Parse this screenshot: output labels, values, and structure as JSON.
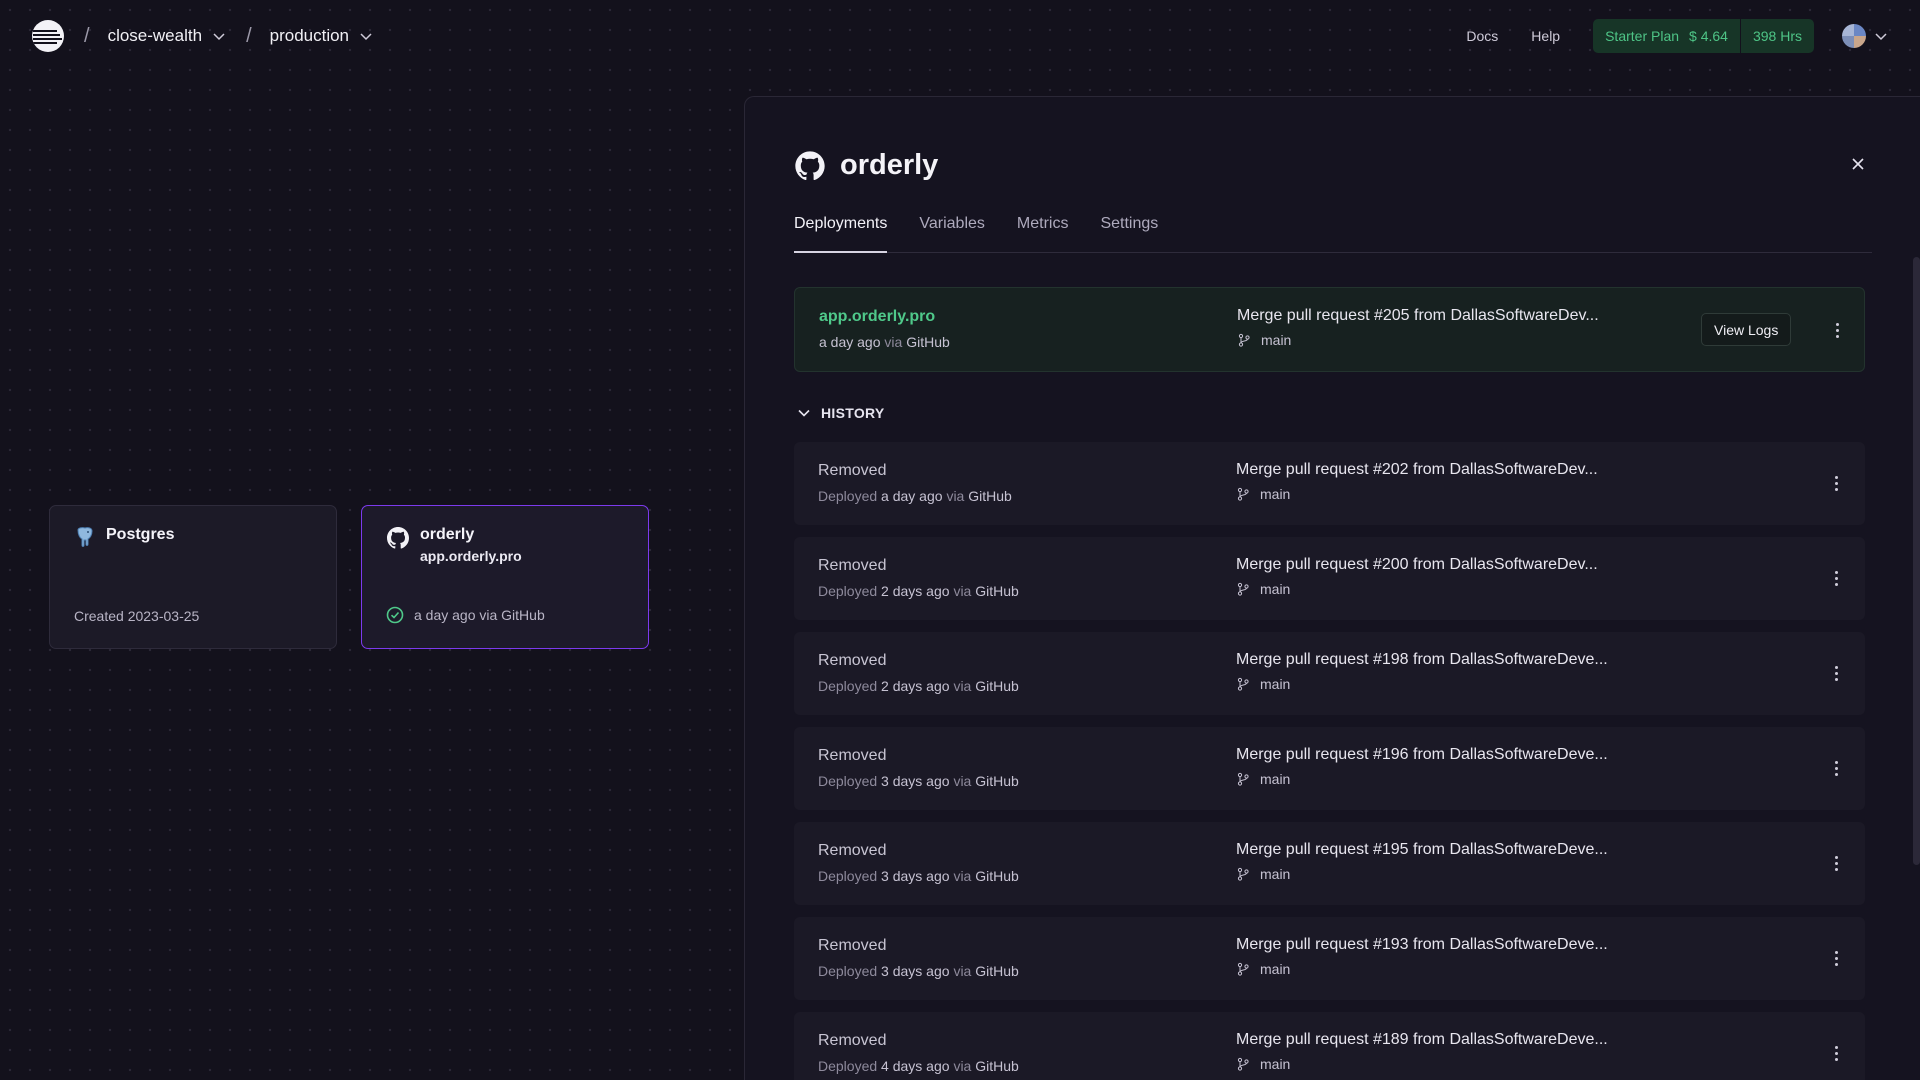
{
  "topbar": {
    "project": "close-wealth",
    "environment": "production",
    "links": [
      "Docs",
      "Help"
    ],
    "plan": {
      "name": "Starter Plan",
      "cost": "$ 4.64",
      "hours": "398 Hrs"
    }
  },
  "canvas": {
    "postgres": {
      "title": "Postgres",
      "footer": "Created 2023-03-25",
      "icon": "postgres-elephant-icon"
    },
    "orderly": {
      "title": "orderly",
      "subtitle": "app.orderly.pro",
      "footer": "a day ago via GitHub",
      "icon": "github-icon",
      "status_icon": "check-circle-icon"
    }
  },
  "panel": {
    "title": "orderly",
    "tabs": [
      "Deployments",
      "Variables",
      "Metrics",
      "Settings"
    ],
    "active_tab": "Deployments",
    "active_deployment": {
      "domain": "app.orderly.pro",
      "time": "a day ago",
      "via_word": "via",
      "source": "GitHub",
      "commit": "Merge pull request #205 from DallasSoftwareDev...",
      "branch": "main",
      "view_logs": "View Logs"
    },
    "history_label": "HISTORY",
    "history": [
      {
        "status": "Removed",
        "deployed_word": "Deployed",
        "time": "a day ago",
        "via_word": "via",
        "source": "GitHub",
        "commit": "Merge pull request #202 from DallasSoftwareDev...",
        "branch": "main"
      },
      {
        "status": "Removed",
        "deployed_word": "Deployed",
        "time": "2 days ago",
        "via_word": "via",
        "source": "GitHub",
        "commit": "Merge pull request #200 from DallasSoftwareDev...",
        "branch": "main"
      },
      {
        "status": "Removed",
        "deployed_word": "Deployed",
        "time": "2 days ago",
        "via_word": "via",
        "source": "GitHub",
        "commit": "Merge pull request #198 from DallasSoftwareDeve...",
        "branch": "main"
      },
      {
        "status": "Removed",
        "deployed_word": "Deployed",
        "time": "3 days ago",
        "via_word": "via",
        "source": "GitHub",
        "commit": "Merge pull request #196 from DallasSoftwareDeve...",
        "branch": "main"
      },
      {
        "status": "Removed",
        "deployed_word": "Deployed",
        "time": "3 days ago",
        "via_word": "via",
        "source": "GitHub",
        "commit": "Merge pull request #195 from DallasSoftwareDeve...",
        "branch": "main"
      },
      {
        "status": "Removed",
        "deployed_word": "Deployed",
        "time": "3 days ago",
        "via_word": "via",
        "source": "GitHub",
        "commit": "Merge pull request #193 from DallasSoftwareDeve...",
        "branch": "main"
      },
      {
        "status": "Removed",
        "deployed_word": "Deployed",
        "time": "4 days ago",
        "via_word": "via",
        "source": "GitHub",
        "commit": "Merge pull request #189 from DallasSoftwareDeve...",
        "branch": "main"
      }
    ]
  },
  "colors": {
    "accent_green": "#4fc98a",
    "selected_border": "#7c3aed",
    "background": "#13111c"
  }
}
